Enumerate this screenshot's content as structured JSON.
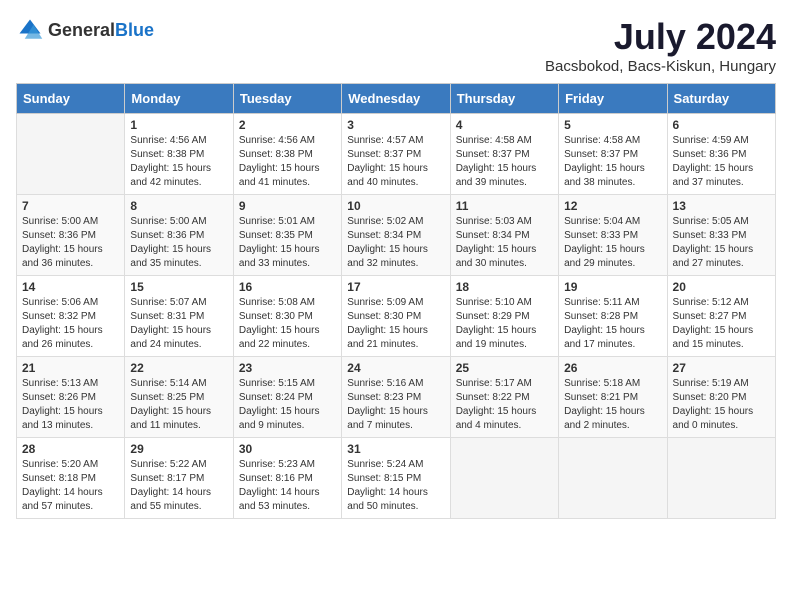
{
  "header": {
    "logo_general": "General",
    "logo_blue": "Blue",
    "month": "July 2024",
    "location": "Bacsbokod, Bacs-Kiskun, Hungary"
  },
  "weekdays": [
    "Sunday",
    "Monday",
    "Tuesday",
    "Wednesday",
    "Thursday",
    "Friday",
    "Saturday"
  ],
  "weeks": [
    [
      {
        "day": "",
        "info": ""
      },
      {
        "day": "1",
        "info": "Sunrise: 4:56 AM\nSunset: 8:38 PM\nDaylight: 15 hours\nand 42 minutes."
      },
      {
        "day": "2",
        "info": "Sunrise: 4:56 AM\nSunset: 8:38 PM\nDaylight: 15 hours\nand 41 minutes."
      },
      {
        "day": "3",
        "info": "Sunrise: 4:57 AM\nSunset: 8:37 PM\nDaylight: 15 hours\nand 40 minutes."
      },
      {
        "day": "4",
        "info": "Sunrise: 4:58 AM\nSunset: 8:37 PM\nDaylight: 15 hours\nand 39 minutes."
      },
      {
        "day": "5",
        "info": "Sunrise: 4:58 AM\nSunset: 8:37 PM\nDaylight: 15 hours\nand 38 minutes."
      },
      {
        "day": "6",
        "info": "Sunrise: 4:59 AM\nSunset: 8:36 PM\nDaylight: 15 hours\nand 37 minutes."
      }
    ],
    [
      {
        "day": "7",
        "info": "Sunrise: 5:00 AM\nSunset: 8:36 PM\nDaylight: 15 hours\nand 36 minutes."
      },
      {
        "day": "8",
        "info": "Sunrise: 5:00 AM\nSunset: 8:36 PM\nDaylight: 15 hours\nand 35 minutes."
      },
      {
        "day": "9",
        "info": "Sunrise: 5:01 AM\nSunset: 8:35 PM\nDaylight: 15 hours\nand 33 minutes."
      },
      {
        "day": "10",
        "info": "Sunrise: 5:02 AM\nSunset: 8:34 PM\nDaylight: 15 hours\nand 32 minutes."
      },
      {
        "day": "11",
        "info": "Sunrise: 5:03 AM\nSunset: 8:34 PM\nDaylight: 15 hours\nand 30 minutes."
      },
      {
        "day": "12",
        "info": "Sunrise: 5:04 AM\nSunset: 8:33 PM\nDaylight: 15 hours\nand 29 minutes."
      },
      {
        "day": "13",
        "info": "Sunrise: 5:05 AM\nSunset: 8:33 PM\nDaylight: 15 hours\nand 27 minutes."
      }
    ],
    [
      {
        "day": "14",
        "info": "Sunrise: 5:06 AM\nSunset: 8:32 PM\nDaylight: 15 hours\nand 26 minutes."
      },
      {
        "day": "15",
        "info": "Sunrise: 5:07 AM\nSunset: 8:31 PM\nDaylight: 15 hours\nand 24 minutes."
      },
      {
        "day": "16",
        "info": "Sunrise: 5:08 AM\nSunset: 8:30 PM\nDaylight: 15 hours\nand 22 minutes."
      },
      {
        "day": "17",
        "info": "Sunrise: 5:09 AM\nSunset: 8:30 PM\nDaylight: 15 hours\nand 21 minutes."
      },
      {
        "day": "18",
        "info": "Sunrise: 5:10 AM\nSunset: 8:29 PM\nDaylight: 15 hours\nand 19 minutes."
      },
      {
        "day": "19",
        "info": "Sunrise: 5:11 AM\nSunset: 8:28 PM\nDaylight: 15 hours\nand 17 minutes."
      },
      {
        "day": "20",
        "info": "Sunrise: 5:12 AM\nSunset: 8:27 PM\nDaylight: 15 hours\nand 15 minutes."
      }
    ],
    [
      {
        "day": "21",
        "info": "Sunrise: 5:13 AM\nSunset: 8:26 PM\nDaylight: 15 hours\nand 13 minutes."
      },
      {
        "day": "22",
        "info": "Sunrise: 5:14 AM\nSunset: 8:25 PM\nDaylight: 15 hours\nand 11 minutes."
      },
      {
        "day": "23",
        "info": "Sunrise: 5:15 AM\nSunset: 8:24 PM\nDaylight: 15 hours\nand 9 minutes."
      },
      {
        "day": "24",
        "info": "Sunrise: 5:16 AM\nSunset: 8:23 PM\nDaylight: 15 hours\nand 7 minutes."
      },
      {
        "day": "25",
        "info": "Sunrise: 5:17 AM\nSunset: 8:22 PM\nDaylight: 15 hours\nand 4 minutes."
      },
      {
        "day": "26",
        "info": "Sunrise: 5:18 AM\nSunset: 8:21 PM\nDaylight: 15 hours\nand 2 minutes."
      },
      {
        "day": "27",
        "info": "Sunrise: 5:19 AM\nSunset: 8:20 PM\nDaylight: 15 hours\nand 0 minutes."
      }
    ],
    [
      {
        "day": "28",
        "info": "Sunrise: 5:20 AM\nSunset: 8:18 PM\nDaylight: 14 hours\nand 57 minutes."
      },
      {
        "day": "29",
        "info": "Sunrise: 5:22 AM\nSunset: 8:17 PM\nDaylight: 14 hours\nand 55 minutes."
      },
      {
        "day": "30",
        "info": "Sunrise: 5:23 AM\nSunset: 8:16 PM\nDaylight: 14 hours\nand 53 minutes."
      },
      {
        "day": "31",
        "info": "Sunrise: 5:24 AM\nSunset: 8:15 PM\nDaylight: 14 hours\nand 50 minutes."
      },
      {
        "day": "",
        "info": ""
      },
      {
        "day": "",
        "info": ""
      },
      {
        "day": "",
        "info": ""
      }
    ]
  ]
}
